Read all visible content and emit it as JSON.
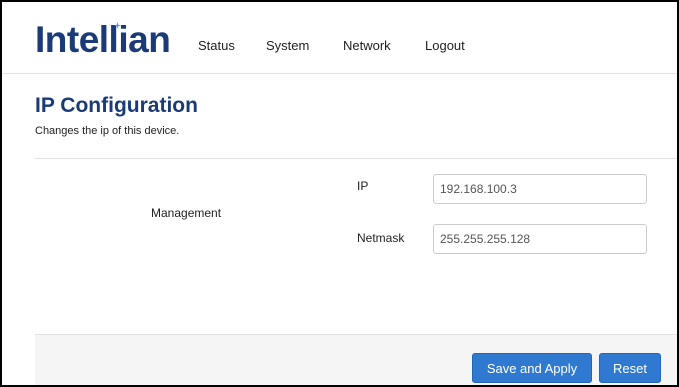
{
  "header": {
    "logo_text": "Intellian",
    "nav": [
      {
        "label": "Status"
      },
      {
        "label": "System"
      },
      {
        "label": "Network"
      },
      {
        "label": "Logout"
      }
    ]
  },
  "page": {
    "title": "IP Configuration",
    "subtitle": "Changes the ip of this device."
  },
  "form": {
    "section_label": "Management",
    "ip_label": "IP",
    "ip_value": "192.168.100.3",
    "netmask_label": "Netmask",
    "netmask_value": "255.255.255.128"
  },
  "actions": {
    "save_label": "Save and Apply",
    "reset_label": "Reset"
  },
  "colors": {
    "brand": "#1a3a78",
    "accent": "#2f7ad0",
    "logo_dot": "#4aa3df"
  }
}
